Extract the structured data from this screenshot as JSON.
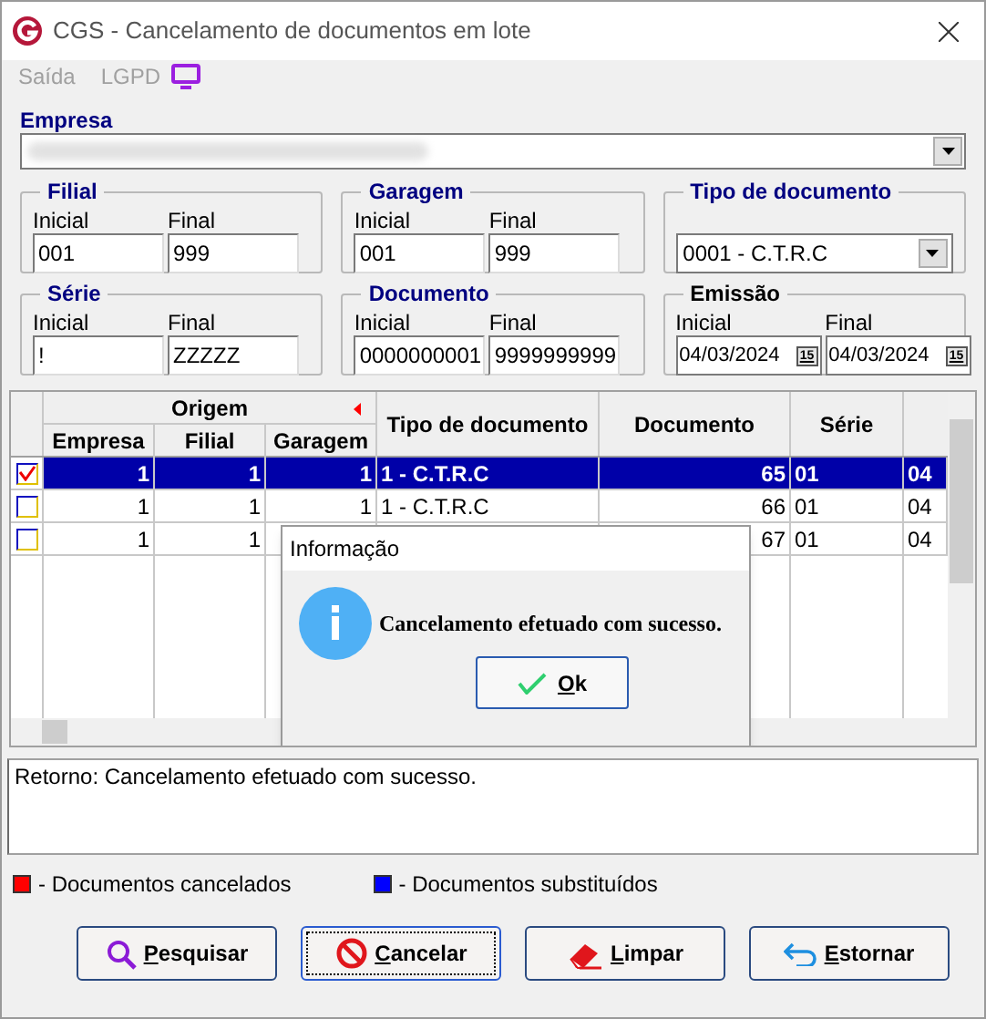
{
  "window": {
    "title": "CGS - Cancelamento de documentos em lote"
  },
  "menu": [
    "Saída",
    "LGPD"
  ],
  "company": {
    "label": "Empresa"
  },
  "groups": [
    {
      "kind": "range",
      "title": "Filial",
      "emphasis": true,
      "start_label": "Inicial",
      "start_value": "001",
      "end_label": "Final",
      "end_value": "999"
    },
    {
      "kind": "range",
      "title": "Garagem",
      "emphasis": true,
      "start_label": "Inicial",
      "start_value": "001",
      "end_label": "Final",
      "end_value": "999"
    },
    {
      "kind": "select",
      "title": "Tipo de documento",
      "emphasis": true,
      "value": "0001 - C.T.R.C"
    },
    {
      "kind": "range",
      "title": "Série",
      "emphasis": true,
      "start_label": "Inicial",
      "start_value": "!",
      "end_label": "Final",
      "end_value": "ZZZZZ"
    },
    {
      "kind": "range",
      "title": "Documento",
      "emphasis": true,
      "start_label": "Inicial",
      "start_value": "0000000001",
      "end_label": "Final",
      "end_value": "9999999999"
    },
    {
      "kind": "date_range",
      "title": "Emissão",
      "emphasis": false,
      "start_label": "Inicial",
      "start_value": "04/03/2024",
      "end_label": "Final",
      "end_value": "04/03/2024",
      "start_calendar": "15",
      "end_calendar": "15"
    }
  ],
  "grid": {
    "group_header": "Origem",
    "columns": [
      "Empresa",
      "Filial",
      "Garagem",
      "Tipo de documento",
      "Documento",
      "Série"
    ],
    "rows": [
      {
        "checked": true,
        "selected": true,
        "cells": [
          "1",
          "1",
          "1",
          "1 - C.T.R.C",
          "65",
          "01",
          "04"
        ]
      },
      {
        "checked": false,
        "selected": false,
        "cells": [
          "1",
          "1",
          "1",
          "1 - C.T.R.C",
          "66",
          "01",
          "04"
        ]
      },
      {
        "checked": false,
        "selected": false,
        "cells": [
          "1",
          "1",
          null,
          null,
          "67",
          "01",
          "04"
        ]
      }
    ]
  },
  "dialog": {
    "title": "Informação",
    "message": "Cancelamento efetuado com sucesso.",
    "button": "Ok"
  },
  "memo": "Retorno: Cancelamento efetuado com sucesso.",
  "legend": [
    {
      "label": "- Documentos cancelados",
      "color": "#ff0000"
    },
    {
      "label": "- Documentos substituídos",
      "color": "#0000ff"
    }
  ],
  "buttons": [
    {
      "kind": "search",
      "label": "Pesquisar",
      "focused": false
    },
    {
      "kind": "cancel",
      "label": "Cancelar",
      "focused": true
    },
    {
      "kind": "eraser",
      "label": "Limpar",
      "focused": false
    },
    {
      "kind": "undo",
      "label": "Estornar",
      "focused": false
    }
  ]
}
